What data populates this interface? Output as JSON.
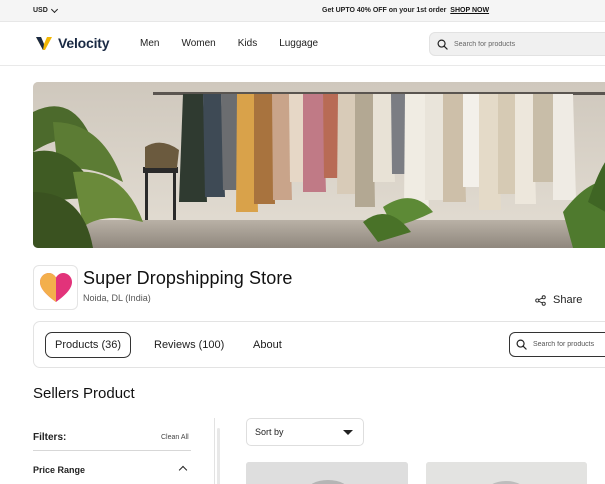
{
  "topbar": {
    "currency": "USD",
    "promo_text": "Get UPTO 40% OFF on your 1st order",
    "promo_link": "SHOP NOW"
  },
  "nav": {
    "brand": "Velocity",
    "links": [
      "Men",
      "Women",
      "Kids",
      "Luggage"
    ],
    "search_placeholder": "Search for products"
  },
  "store": {
    "name": "Super Dropshipping Store",
    "location": "Noida, DL (India)",
    "share_label": "Share"
  },
  "tabs": {
    "items": [
      {
        "label": "Products (36)"
      },
      {
        "label": "Reviews (100)"
      },
      {
        "label": "About"
      }
    ],
    "search_placeholder": "Search for products"
  },
  "main": {
    "section_title": "Sellers Product",
    "sort_label": "Sort by"
  },
  "sidebar": {
    "filters_label": "Filters:",
    "clean_all": "Clean All",
    "price_range": "Price Range"
  },
  "colors": {
    "brand_navy": "#1a2a44",
    "brand_yellow": "#f2b705",
    "store_logo_pink": "#e2337a",
    "store_logo_yellow": "#f6c544"
  }
}
